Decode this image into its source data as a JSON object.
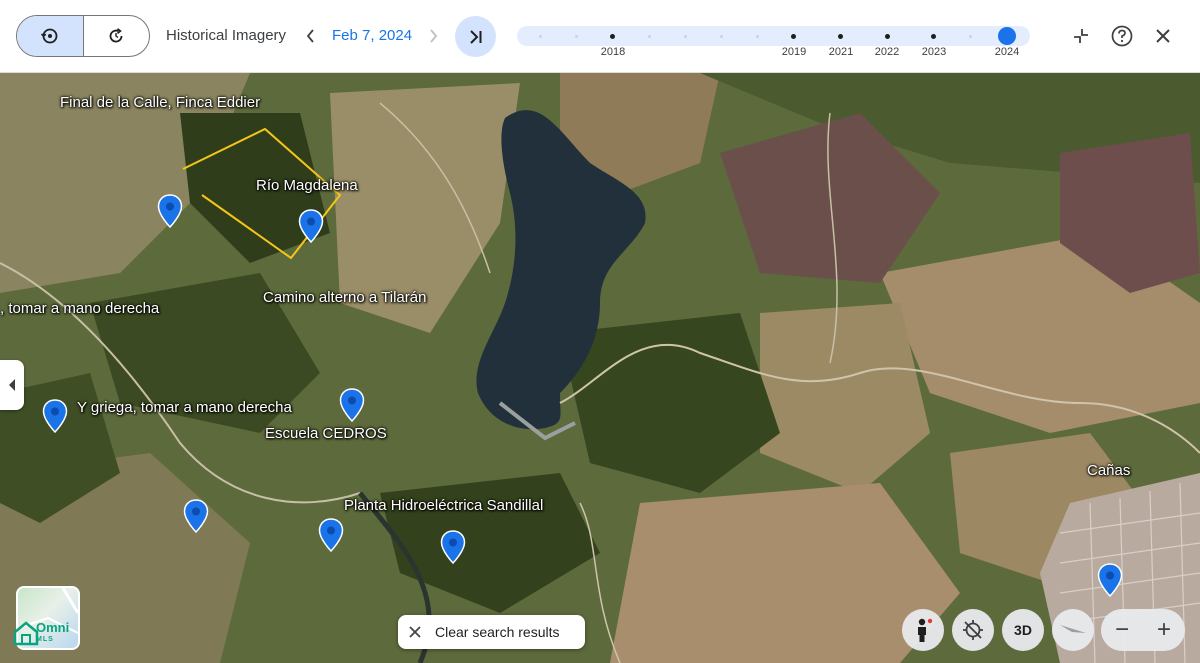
{
  "toolbar": {
    "mode_buttons": [
      {
        "icon": "history-icon",
        "active": true
      },
      {
        "icon": "refresh-icon",
        "active": false
      }
    ],
    "title": "Historical Imagery",
    "date": "Feb 7, 2024",
    "prev_icon": "chevron-left-icon",
    "next_icon": "chevron-right-icon",
    "latest_icon": "skip-to-latest-icon",
    "timeline_years": [
      "2018",
      "2019",
      "2021",
      "2022",
      "2023",
      "2024"
    ],
    "timeline_selected": "2024",
    "tools": [
      "collapse-icon",
      "help-icon",
      "close-icon"
    ]
  },
  "map": {
    "places": [
      {
        "label": "Final de la Calle, Finca Eddier"
      },
      {
        "label": "Río Magdalena"
      },
      {
        "label": ", tomar a mano derecha"
      },
      {
        "label": "Camino alterno a Tilarán"
      },
      {
        "label": "Y griega, tomar a mano derecha"
      },
      {
        "label": "Escuela CEDROS"
      },
      {
        "label": "Planta Hidroeléctrica Sandillal"
      },
      {
        "label": "Cañas"
      }
    ],
    "boundary_color": "#f5c518",
    "pin_color": "#1a73e8"
  },
  "controls": {
    "clear_label": "Clear search results",
    "logo_text": "Omni",
    "logo_sub": "MLS",
    "button_3d": "3D",
    "zoom_out": "−",
    "zoom_in": "+"
  }
}
